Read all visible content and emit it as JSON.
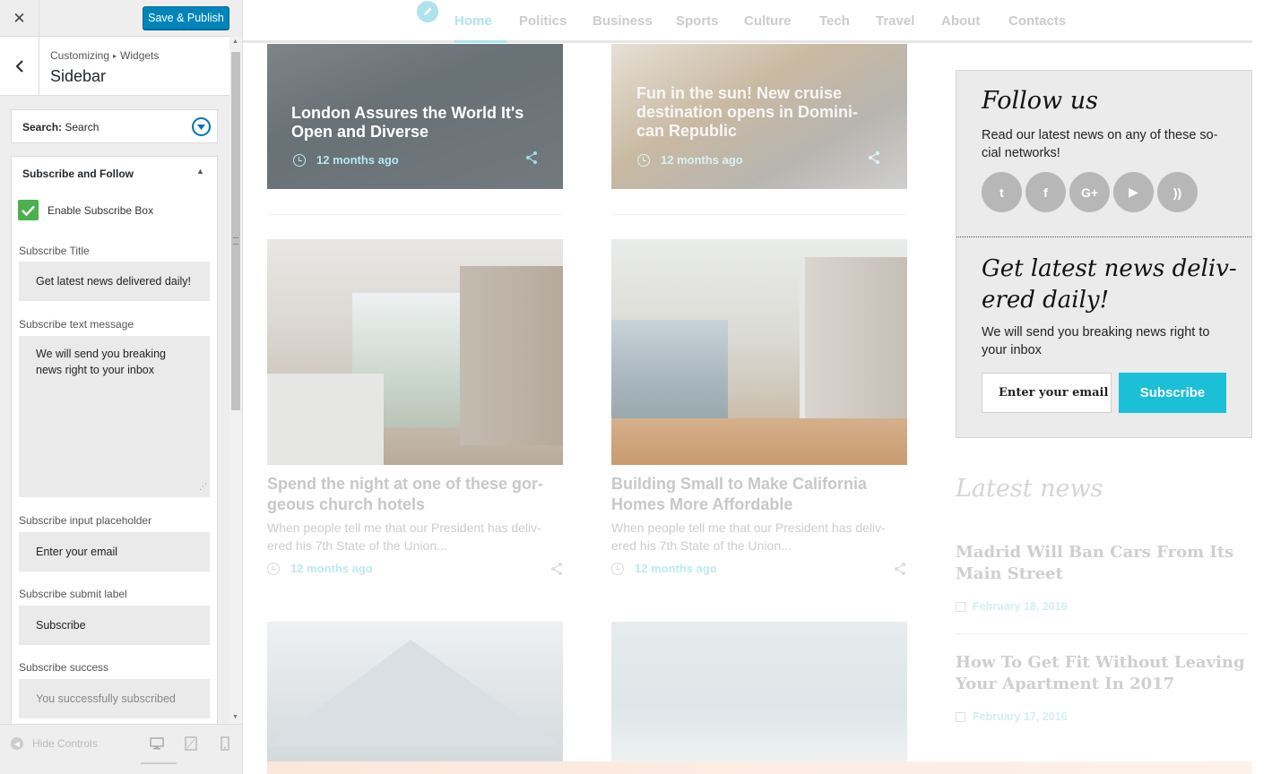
{
  "customizer": {
    "close_symbol": "✕",
    "publish_label": "Save & Publish",
    "breadcrumb": {
      "part1": "Customizing",
      "separator": "▸",
      "part2": "Widgets"
    },
    "panel_title": "Sidebar",
    "widgets": {
      "search": {
        "prefix": "Search:",
        "title": "Search"
      },
      "subscribe": {
        "title": "Subscribe and Follow",
        "enable_label": "Enable Subscribe Box",
        "enable_checked": true,
        "fields": {
          "title_label": "Subscribe Title",
          "title_value": "Get latest news delivered daily!",
          "message_label": "Subscribe text message",
          "message_value": "We will send you breaking\nnews right to your inbox",
          "placeholder_label": "Subscribe input placeholder",
          "placeholder_value": "Enter your email",
          "submit_label": "Subscribe submit label",
          "submit_value": "Subscribe",
          "success_label": "Subscribe success",
          "success_value": "You successfully subscribed"
        }
      }
    },
    "footer": {
      "hide_controls": "Hide Controls",
      "devices": [
        "desktop-icon",
        "tablet-icon",
        "mobile-icon"
      ]
    }
  },
  "preview": {
    "nav": [
      "Home",
      "Politics",
      "Business",
      "Sports",
      "Culture",
      "Tech",
      "Travel",
      "About",
      "Contacts"
    ],
    "active_nav": "Home",
    "cards_top": [
      {
        "title": "London Assures the World It's Open and Diverse",
        "date": "12 months ago"
      },
      {
        "title": "Fun in the sun! New cruise destination opens in Domini-can Republic",
        "date": "12 months ago"
      }
    ],
    "posts": [
      {
        "title": "Spend the night at one of these gor-geous church hotels",
        "excerpt": "When people tell me that our President has deliv-ered his 7th State of the Union...",
        "date": "12 months ago"
      },
      {
        "title": "Building Small to Make California Homes More Affordable",
        "excerpt": "When people tell me that our President has deliv-ered his 7th State of the Union...",
        "date": "12 months ago"
      }
    ],
    "sidebar": {
      "follow_title": "Follow us",
      "follow_text": "Read our latest news on any of these so-cial networks!",
      "social": [
        {
          "name": "twitter-icon",
          "glyph": "t"
        },
        {
          "name": "facebook-icon",
          "glyph": "f"
        },
        {
          "name": "google-plus-icon",
          "glyph": "G+"
        },
        {
          "name": "youtube-icon",
          "glyph": "▶"
        },
        {
          "name": "rss-icon",
          "glyph": "))"
        }
      ],
      "subscribe_title": "Get latest news deliv-ered daily!",
      "subscribe_text": "We will send you breaking news right to your inbox",
      "subscribe_placeholder": "Enter your email",
      "subscribe_button": "Subscribe",
      "latest_title": "Latest news",
      "latest": [
        {
          "title": "Madrid Will Ban Cars From Its Main Street",
          "date": "February 18, 2016"
        },
        {
          "title": "How To Get Fit Without Leaving Your Apartment In 2017",
          "date": "February 17, 2016"
        }
      ]
    },
    "colors": {
      "accent": "#1bbfd6",
      "publish": "#0085ba",
      "check": "#4caf50"
    }
  }
}
